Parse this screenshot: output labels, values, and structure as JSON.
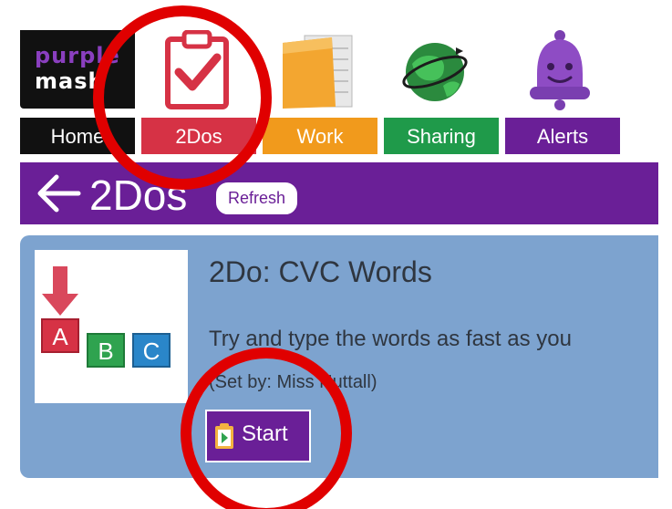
{
  "logo": {
    "line1": "purple",
    "line2": "mash"
  },
  "nav": {
    "home": "Home",
    "twodos": "2Dos",
    "work": "Work",
    "sharing": "Sharing",
    "alerts": "Alerts"
  },
  "header": {
    "title": "2Dos",
    "refresh_label": "Refresh"
  },
  "card": {
    "title": "2Do: CVC Words",
    "description": "Try and type the words as fast as you",
    "set_by": "(Set by: Miss Nuttall)",
    "start_label": "Start",
    "blocks": [
      "A",
      "B",
      "C"
    ]
  },
  "colors": {
    "purple": "#6a1f97",
    "red": "#d63245",
    "orange": "#f19a1c",
    "green": "#1f9a4a",
    "card_blue": "#7da3cf",
    "annotation_red": "#e00000"
  }
}
